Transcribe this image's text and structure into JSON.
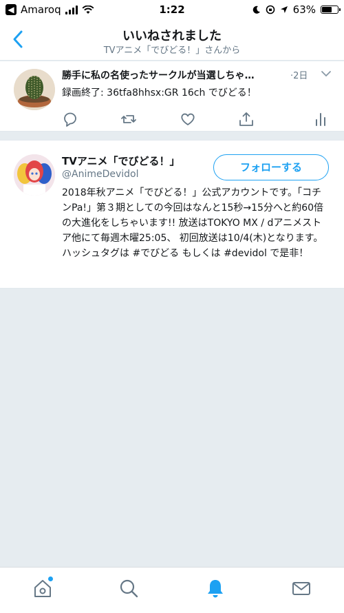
{
  "status_bar": {
    "carrier": "Amaroq",
    "time": "1:22",
    "battery": "63%",
    "battery_level": 0.63
  },
  "nav": {
    "title": "いいねされました",
    "subtitle": "TVアニメ「でびどる！」さんから"
  },
  "tweet": {
    "title": "勝手に私の名使ったサークルが当選しちゃ…",
    "time": "·2日",
    "text": "録画終了: 36tfa8hhsx:GR 16ch でびどる！",
    "actions": [
      "reply-icon",
      "retweet-icon",
      "like-icon",
      "share-icon",
      "analytics-icon"
    ]
  },
  "user": {
    "name": "TVアニメ「でびどる！」",
    "handle": "@AnimeDevidol",
    "follow_label": "フォローする",
    "bio": "2018年秋アニメ「でびどる！」公式アカウントです。「コチンPa!」第３期としての今回はなんと15秒→15分へと約60倍の大進化をしちゃいます!! 放送はTOKYO MX / dアニメストア他にて毎週木曜25:05、 初回放送は10/4(木)となります。ハッシュタグは #でびどる もしくは #devidol で是非！"
  },
  "tab_bar": {
    "tabs": [
      "home-icon",
      "search-icon",
      "notifications-icon",
      "messages-icon"
    ],
    "active": "notifications-icon"
  },
  "colors": {
    "accent": "#1da1f2",
    "text": "#14171a",
    "secondary": "#657786",
    "background": "#e6ecf0"
  }
}
